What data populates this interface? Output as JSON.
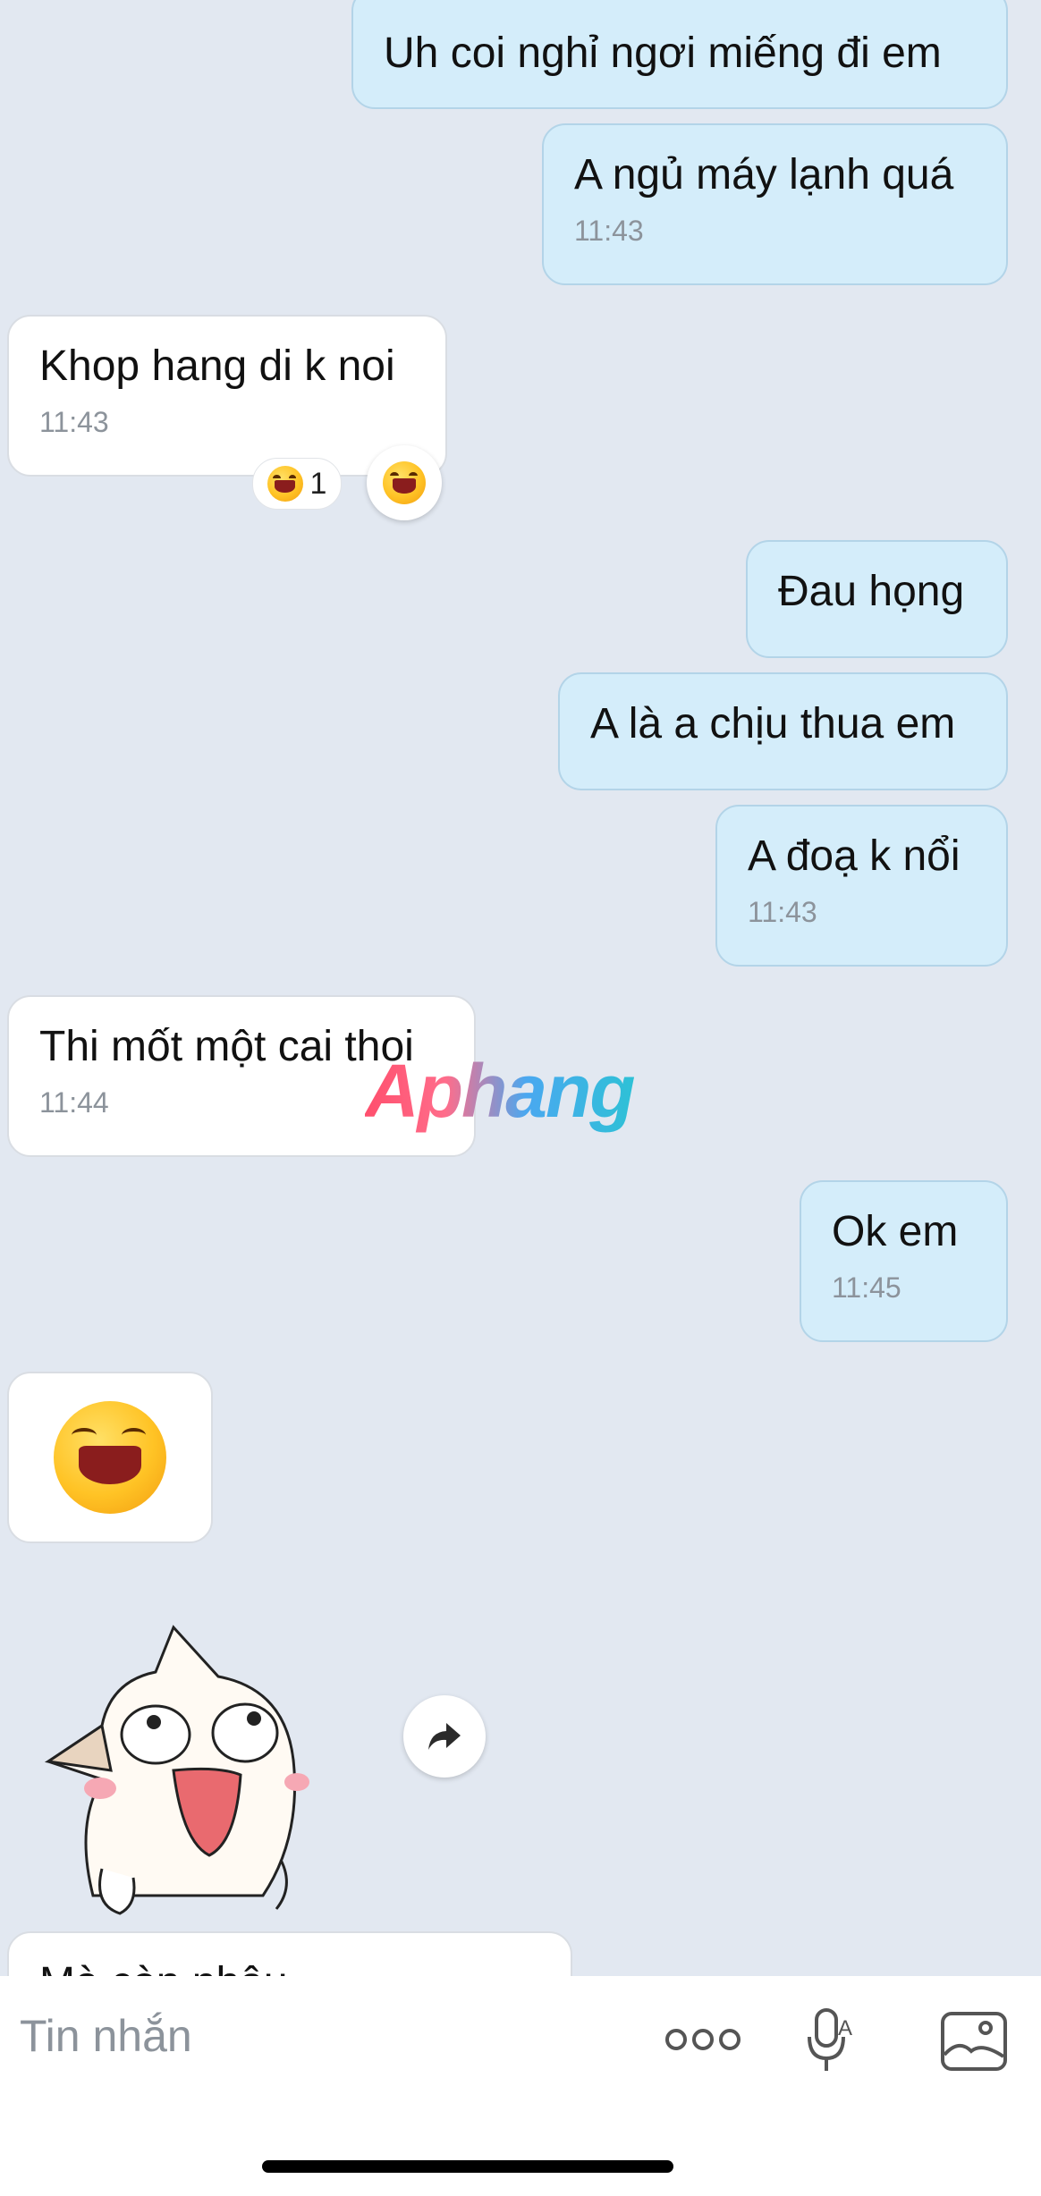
{
  "messages": [
    {
      "dir": "out",
      "text": "Uh coi nghỉ ngơi miếng đi em",
      "time": ""
    },
    {
      "dir": "out",
      "text": "A ngủ máy lạnh quá",
      "time": "11:43"
    },
    {
      "dir": "in",
      "text": "Khop hang di k noi",
      "time": "11:43"
    },
    {
      "dir": "out",
      "text": "Đau họng",
      "time": ""
    },
    {
      "dir": "out",
      "text": "A là a chịu thua em",
      "time": ""
    },
    {
      "dir": "out",
      "text": "A đoạ k nổi",
      "time": "11:43"
    },
    {
      "dir": "in",
      "text": "Thi mốt một cai thoi",
      "time": "11:44"
    },
    {
      "dir": "out",
      "text": "Ok em",
      "time": "11:45"
    },
    {
      "dir": "in",
      "text": "Mà còn nhậu",
      "time": ""
    }
  ],
  "reaction": {
    "count": "1",
    "icon": "laughing-emoji-icon"
  },
  "watermark": "Aphang",
  "composer": {
    "placeholder": "Tin nhắn",
    "more_icon": "more-dots-icon",
    "voice_icon": "voice-to-text-icon",
    "gallery_icon": "image-gallery-icon"
  },
  "colors": {
    "background": "#e2e8f1",
    "outgoing": "#d4edfa",
    "incoming": "#ffffff",
    "time": "#8c939b"
  }
}
